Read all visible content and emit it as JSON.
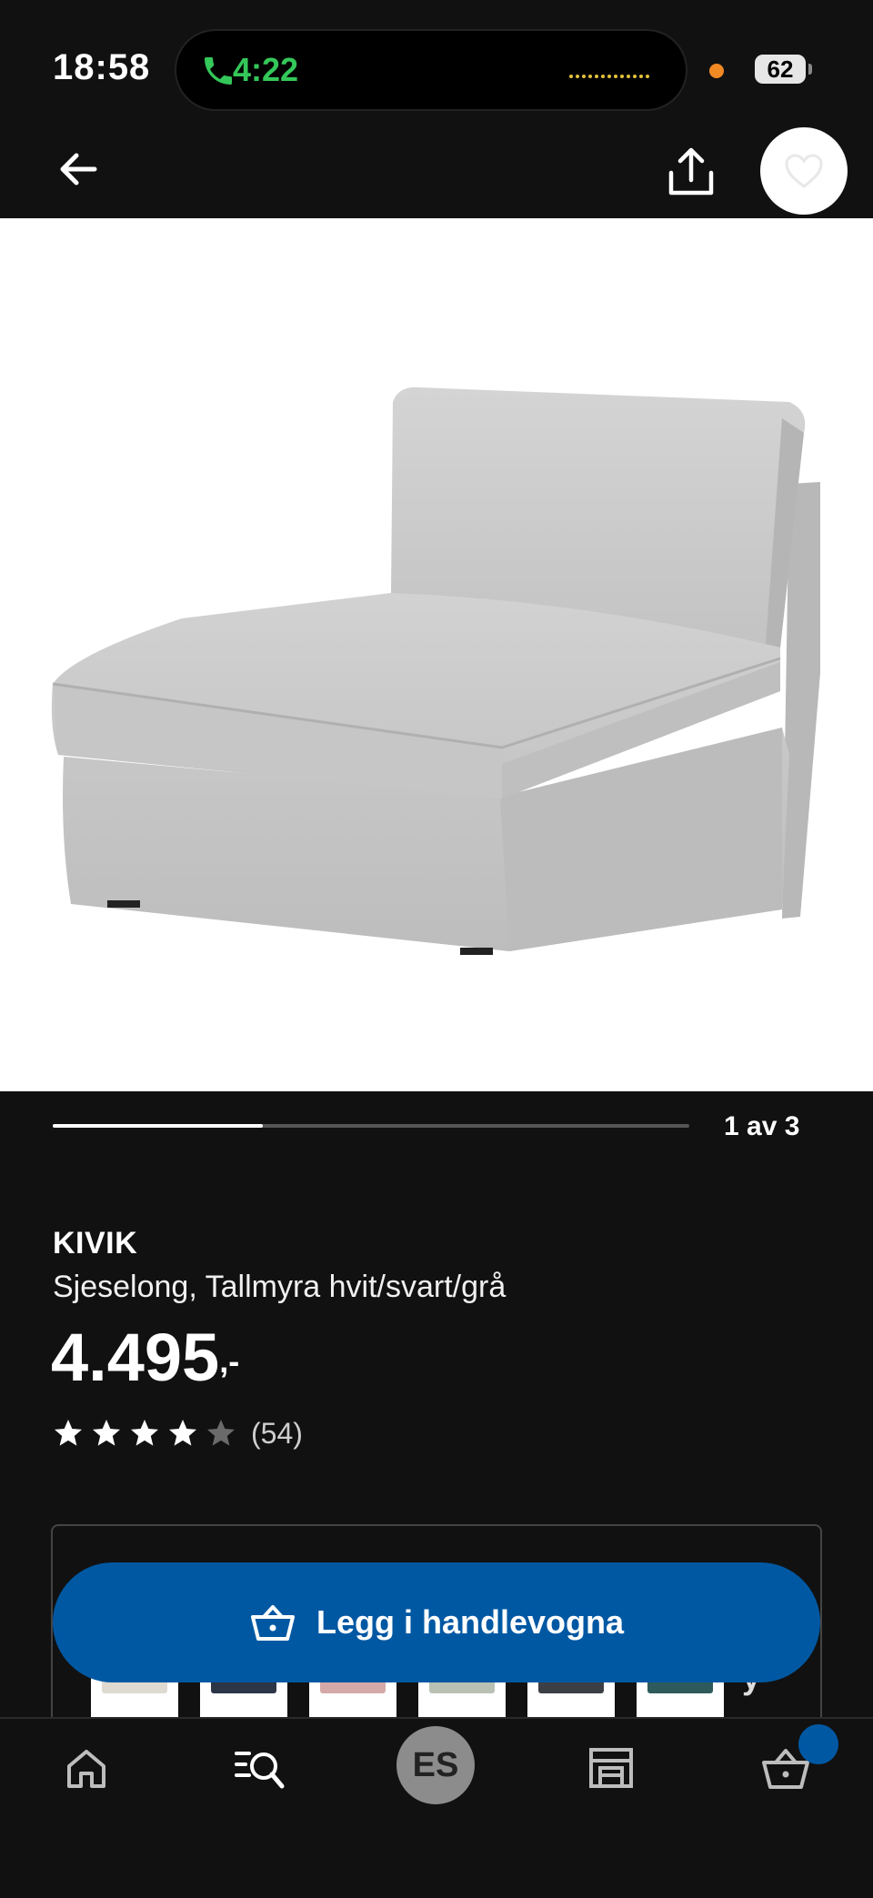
{
  "status_bar": {
    "time": "18:58",
    "call_duration": "4:22",
    "battery": "62"
  },
  "nav": {
    "back": "back-arrow-icon",
    "share": "share-icon",
    "favorite": "heart-icon"
  },
  "gallery": {
    "page_indicator": "1 av 3",
    "current_page": 1,
    "total_pages": 3,
    "progress_fraction": 0.33
  },
  "product": {
    "brand": "KIVIK",
    "description": "Sjeselong, Tallmyra hvit/svart/grå",
    "price_main": "4.495",
    "price_suffix": ",-",
    "rating": 4,
    "rating_max": 5,
    "review_count": "(54)"
  },
  "variants": {
    "colors": [
      "#dedad2",
      "#2c3646",
      "#d5a9a8",
      "#b9c1b4",
      "#3d3f47",
      "#2f5a5c"
    ],
    "partial_text": "y"
  },
  "cta": {
    "label": "Legg i handlevogna",
    "color": "#0058a3"
  },
  "tab_bar": {
    "home": "home-icon",
    "search": "search-list-icon",
    "account_initials": "ES",
    "store": "store-icon",
    "cart": "basket-icon"
  }
}
